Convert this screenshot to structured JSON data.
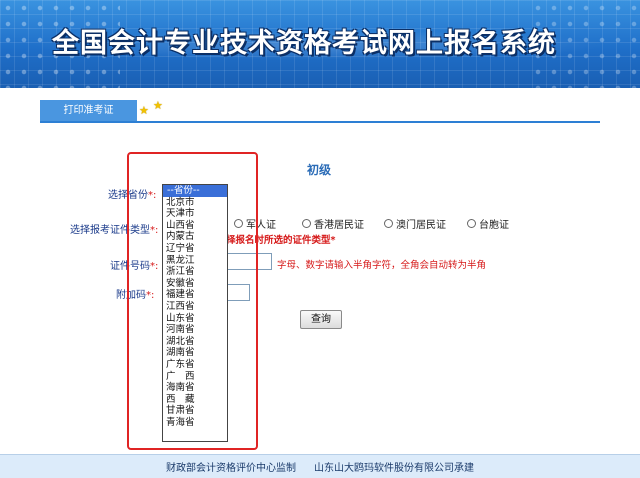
{
  "header": {
    "title": "全国会计专业技术资格考试网上报名系统"
  },
  "tab": {
    "label": "打印准考证"
  },
  "form": {
    "level": "初级",
    "province_label": "选择省份",
    "cert_type_label": "选择报考证件类型",
    "id_number_label": "证件号码",
    "extra_code_label": "附加码",
    "required_mark": "*:",
    "cert_options": [
      "军人证",
      "香港居民证",
      "澳门居民证",
      "台胞证"
    ],
    "cert_warning": "择报名时所选的证件类型*",
    "id_hint": "字母、数字请输入半角字符，全角会自动转为半角",
    "id_number_value": "",
    "extra_code_value": "",
    "query_button": "查询"
  },
  "province_dropdown": {
    "selected": "--省份--",
    "options": [
      "北京市",
      "天津市",
      "山西省",
      "内蒙古",
      "辽宁省",
      "黑龙江",
      "浙江省",
      "安徽省",
      "福建省",
      "江西省",
      "山东省",
      "河南省",
      "湖北省",
      "湖南省",
      "广东省",
      "广　西",
      "海南省",
      "西　藏",
      "甘肃省",
      "青海省"
    ]
  },
  "footer": {
    "supervisor": "财政部会计资格评价中心监制",
    "contractor": "山东山大鸥玛软件股份有限公司承建"
  },
  "colors": {
    "banner": "#1f6fc9",
    "accent": "#2d7fd4",
    "warning": "#d61a1a",
    "highlight_box": "#e02424",
    "selected_option": "#3a6fd8"
  }
}
